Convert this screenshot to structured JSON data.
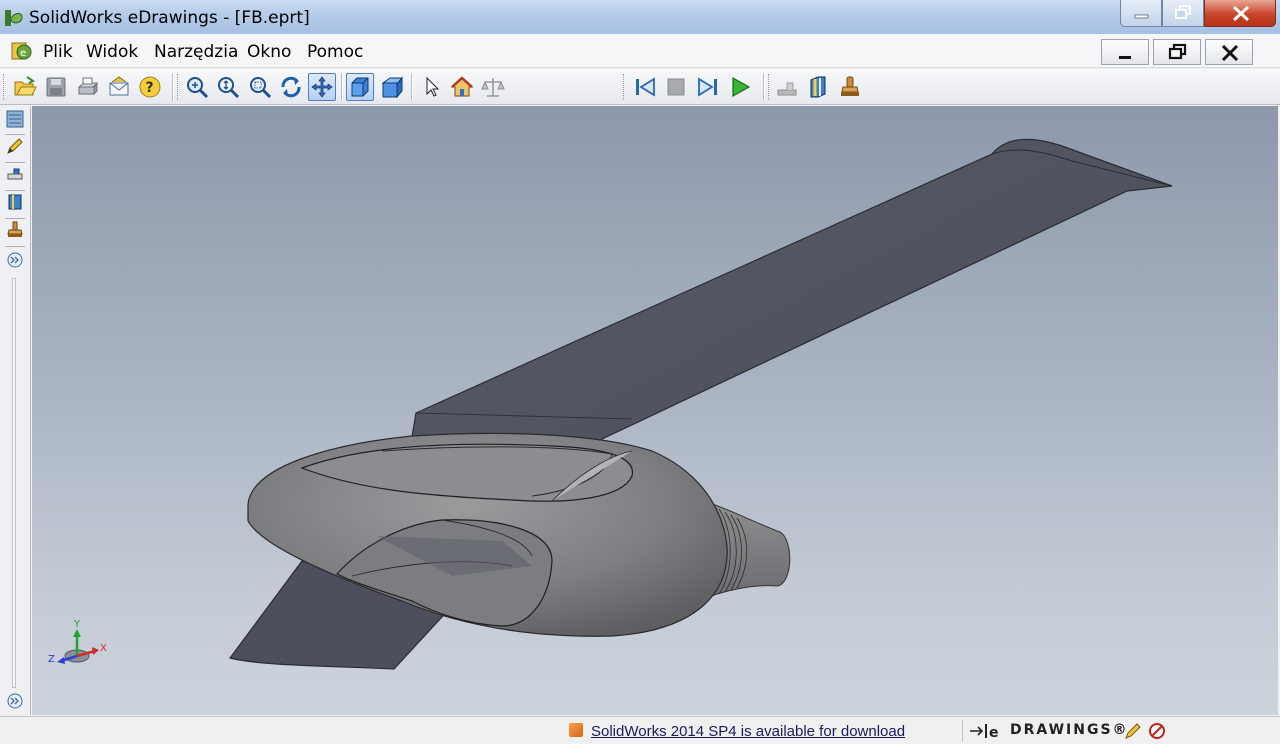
{
  "window": {
    "title": "SolidWorks eDrawings - [FB.eprt]"
  },
  "menubar": {
    "items": [
      "Plik",
      "Widok",
      "Narzędzia",
      "Okno",
      "Pomoc"
    ]
  },
  "toolbar": {
    "file_icons": [
      "open-icon",
      "save-icon",
      "print-icon",
      "email-icon",
      "help-icon"
    ],
    "view_icons": [
      "zoom-to-fit-icon",
      "zoom-in-out-icon",
      "zoom-to-area-icon",
      "rotate-icon",
      "pan-icon"
    ],
    "display_icons": [
      "shaded-icon",
      "perspective-icon"
    ],
    "select_icons": [
      "select-icon",
      "home-icon",
      "mass-properties-icon"
    ],
    "animation_icons": [
      "go-to-start-icon",
      "stop-icon",
      "go-to-end-icon",
      "play-icon"
    ],
    "tools_icons": [
      "measure-icon",
      "section-icon",
      "stamp-icon"
    ]
  },
  "statusbar": {
    "message": "SolidWorks 2014 SP4 is available for download",
    "brand": "DRAWINGS®"
  },
  "triad": {
    "x": "X",
    "y": "Y",
    "z": "Z"
  },
  "colors": {
    "viewport_top": "#8d99ab",
    "viewport_bottom": "#cdd3dc",
    "wing": "#50535f",
    "nacelle": "#8a8b8d"
  }
}
